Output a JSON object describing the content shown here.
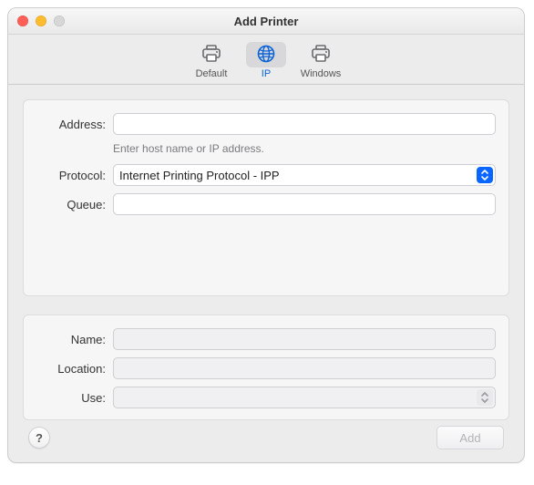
{
  "window": {
    "title": "Add Printer"
  },
  "tabs": {
    "default": "Default",
    "ip": "IP",
    "windows": "Windows",
    "selected": "ip"
  },
  "form": {
    "address_label": "Address:",
    "address_value": "",
    "address_hint": "Enter host name or IP address.",
    "protocol_label": "Protocol:",
    "protocol_selected": "Internet Printing Protocol - IPP",
    "queue_label": "Queue:",
    "queue_value": "",
    "name_label": "Name:",
    "name_value": "",
    "location_label": "Location:",
    "location_value": "",
    "use_label": "Use:",
    "use_selected": ""
  },
  "buttons": {
    "help": "?",
    "add": "Add"
  }
}
